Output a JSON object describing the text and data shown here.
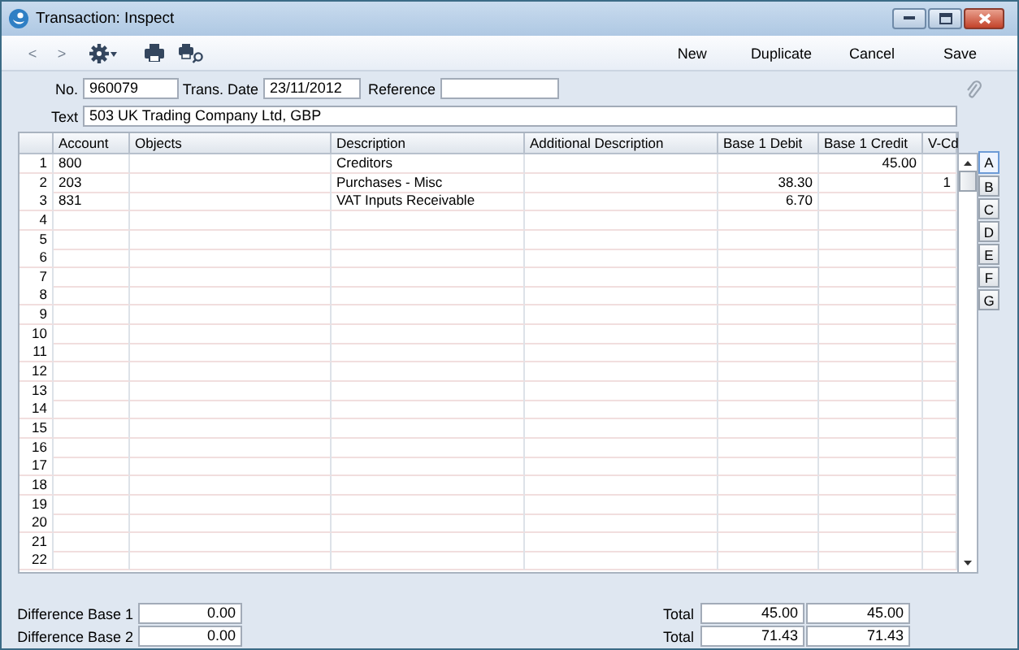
{
  "window": {
    "title": "Transaction: Inspect"
  },
  "toolbar": {
    "nav": [
      "<",
      ">"
    ],
    "buttons": [
      "New",
      "Duplicate",
      "Cancel",
      "Save"
    ]
  },
  "header_fields": [
    {
      "label": "No.",
      "value": "960079"
    },
    {
      "label": "Trans. Date",
      "value": "23/11/2012"
    },
    {
      "label": "Reference"
    }
  ],
  "text_field": {
    "label": "Text",
    "value": "503 UK Trading Company Ltd, GBP"
  },
  "grid": {
    "columns": [
      "Account",
      "Objects",
      "Description",
      "Additional Description",
      "Base 1 Debit",
      "Base 1 Credit",
      "V-Cd"
    ],
    "rows": [
      {
        "number": "1",
        "cells": [
          "800",
          "",
          "Creditors",
          "",
          "",
          "45.00",
          ""
        ]
      },
      {
        "number": "2",
        "cells": [
          "203",
          "",
          "Purchases - Misc",
          "",
          "38.30",
          "",
          "1"
        ]
      },
      {
        "number": "3",
        "cells": [
          "831",
          "",
          "VAT Inputs Receivable",
          "",
          "6.70",
          "",
          ""
        ]
      },
      {
        "number": "4"
      },
      {
        "number": "5"
      },
      {
        "number": "6"
      },
      {
        "number": "7"
      },
      {
        "number": "8"
      },
      {
        "number": "9"
      },
      {
        "number": "10"
      },
      {
        "number": "11"
      },
      {
        "number": "12"
      },
      {
        "number": "13"
      },
      {
        "number": "14"
      },
      {
        "number": "15"
      },
      {
        "number": "16"
      },
      {
        "number": "17"
      },
      {
        "number": "18"
      },
      {
        "number": "19"
      },
      {
        "number": "20"
      },
      {
        "number": "21"
      },
      {
        "number": "22"
      }
    ]
  },
  "page_tabs": [
    {
      "label": "A",
      "selected": true
    },
    {
      "label": "B",
      "selected": false
    },
    {
      "label": "C",
      "selected": false
    },
    {
      "label": "D",
      "selected": false
    },
    {
      "label": "E",
      "selected": false
    },
    {
      "label": "F",
      "selected": false
    },
    {
      "label": "G",
      "selected": false
    }
  ],
  "footer": {
    "differences": [
      {
        "label": "Difference Base 1",
        "value": "0.00"
      },
      {
        "label": "Difference Base 2",
        "value": "0.00"
      }
    ],
    "totals": [
      {
        "label": "Total",
        "debit": "45.00",
        "credit": "45.00"
      },
      {
        "label": "Total",
        "debit": "71.43",
        "credit": "71.43"
      }
    ]
  }
}
